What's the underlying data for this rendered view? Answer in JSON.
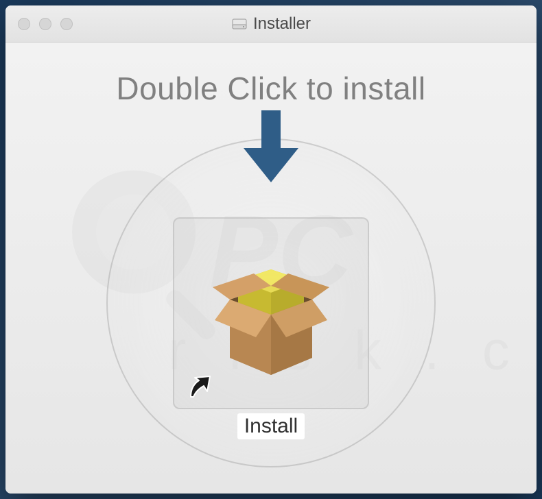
{
  "window": {
    "title": "Installer"
  },
  "content": {
    "instruction": "Double Click to install",
    "icon_label": "Install"
  },
  "colors": {
    "arrow": "#2f5d87",
    "box_light": "#d4a068",
    "box_dark": "#a67845",
    "cube_light": "#e8dd3f",
    "cube_dark": "#c8bd2f"
  }
}
